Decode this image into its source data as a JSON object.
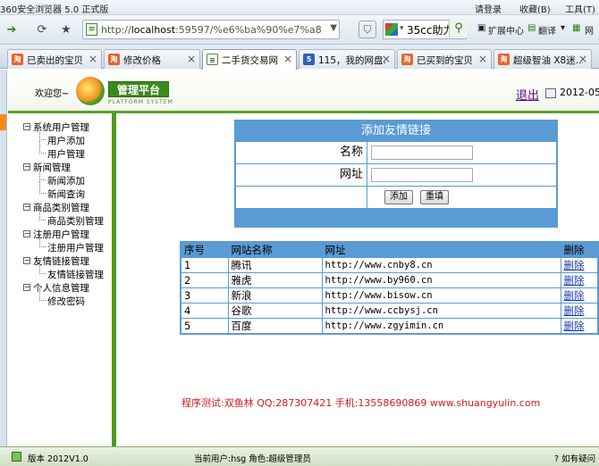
{
  "browser": {
    "title": "360安全浏览器 5.0 正式版",
    "menu": {
      "login": "请登录",
      "favorites": "收藏(B)",
      "tools": "工具(T)"
    },
    "address": {
      "host": "localhost",
      "rest": ":59597/%e6%ba%90%e7%a8%8b%e5"
    },
    "search": {
      "text": "35cc助力"
    },
    "toolbar": {
      "extensions": "扩展中心",
      "translate": "翻译",
      "more": "网"
    },
    "tabs": [
      {
        "label": "已卖出的宝贝",
        "icon": "taobao-icon",
        "active": false
      },
      {
        "label": "修改价格",
        "icon": "taobao-icon",
        "active": false
      },
      {
        "label": "二手货交易网",
        "icon": "page-icon",
        "active": true
      },
      {
        "label": "115，我的网盘...",
        "icon": "cloud-icon",
        "active": false
      },
      {
        "label": "已买到的宝贝",
        "icon": "taobao-icon",
        "active": false
      },
      {
        "label": "超级智油 X8迷...",
        "icon": "taobao-icon",
        "active": false
      }
    ]
  },
  "header": {
    "welcome": "欢迎您~",
    "logo_text": "管理平台",
    "logo_sub": "PLATFORM SYSTEM",
    "logout": "退出",
    "date": "2012-05-"
  },
  "menu": [
    {
      "label": "系统用户管理",
      "children": [
        "用户添加",
        "用户管理"
      ]
    },
    {
      "label": "新闻管理",
      "children": [
        "新闻添加",
        "新闻查询"
      ]
    },
    {
      "label": "商品类别管理",
      "children": [
        "商品类别管理"
      ]
    },
    {
      "label": "注册用户管理",
      "children": [
        "注册用户管理"
      ]
    },
    {
      "label": "友情链接管理",
      "children": [
        "友情链接管理"
      ]
    },
    {
      "label": "个人信息管理",
      "children": [
        "修改密码"
      ]
    }
  ],
  "form": {
    "title": "添加友情链接",
    "name_label": "名称",
    "url_label": "网址",
    "name_value": "",
    "url_value": "",
    "add_button": "添加",
    "reset_button": "重填"
  },
  "links_table": {
    "headers": [
      "序号",
      "网站名称",
      "网址",
      "删除"
    ],
    "rows": [
      {
        "id": "1",
        "name": "腾讯",
        "url": "http://www.cnby8.cn",
        "action": "删除"
      },
      {
        "id": "2",
        "name": "雅虎",
        "url": "http://www.by960.cn",
        "action": "删除"
      },
      {
        "id": "3",
        "name": "新浪",
        "url": "http://www.bisow.cn",
        "action": "删除"
      },
      {
        "id": "4",
        "name": "谷歌",
        "url": "http://www.ccbysj.cn",
        "action": "删除"
      },
      {
        "id": "5",
        "name": "百度",
        "url": "http://www.zgyimin.cn",
        "action": "删除"
      }
    ]
  },
  "tester_note": "程序测试:双鱼林 QQ:287307421 手机:13558690869 www.shuangyulin.com",
  "status": {
    "version": "版本 2012V1.0",
    "current_user": "当前用户:hsg 角色:超级管理员",
    "help": "如有疑问"
  },
  "colors": {
    "accent_green": "#4e9b1e",
    "table_blue": "#5a9bd5",
    "tester_red": "#d21b1b"
  }
}
